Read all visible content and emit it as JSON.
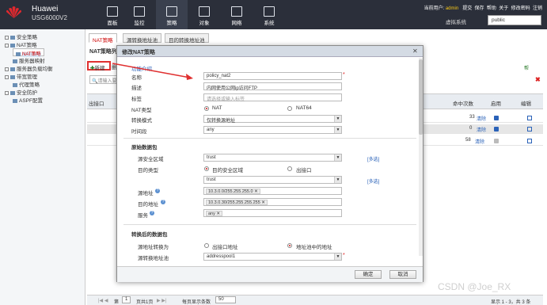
{
  "header": {
    "brand": "Huawei",
    "model": "USG6000V2",
    "nav": [
      {
        "label": "面板"
      },
      {
        "label": "监控"
      },
      {
        "label": "策略"
      },
      {
        "label": "对象"
      },
      {
        "label": "网络"
      },
      {
        "label": "系统"
      }
    ],
    "user_prefix": "当前用户:",
    "user_name": "admin",
    "actions": [
      "提交",
      "保存",
      "帮助",
      "关于",
      "修改密码",
      "注销"
    ],
    "vsys_label": "虚拟系统",
    "vsys_value": "public"
  },
  "sidebar": {
    "items": [
      {
        "label": "安全策略"
      },
      {
        "label": "NAT策略"
      },
      {
        "label": "NAT策略"
      },
      {
        "label": "服务器映射"
      },
      {
        "label": "服务器负载均衡"
      },
      {
        "label": "带宽管理"
      },
      {
        "label": "代理策略"
      },
      {
        "label": "安全防护"
      },
      {
        "label": "ASPF配置"
      }
    ]
  },
  "tabs": [
    {
      "label": "NAT策略"
    },
    {
      "label": "源转换地址池"
    },
    {
      "label": "目的转换地址池"
    }
  ],
  "list": {
    "title": "NAT策略列表",
    "new_button": "新建",
    "new_cut": "删除",
    "search_placeholder": "请输入要",
    "columns": [
      "出接口",
      "命中次数",
      "启用",
      "编辑"
    ],
    "rows": [
      {
        "a": "1",
        "hits": "33",
        "clear": "清除"
      },
      {
        "a": "1",
        "hits": "0",
        "clear": "清除"
      },
      {
        "a": "",
        "hits": "58",
        "clear": "清除"
      }
    ],
    "right_link": "帮",
    "right_del": "✖"
  },
  "pager": {
    "label_page": "第",
    "page": "1",
    "label_total": "页共1页",
    "label_per": "每页显示条数",
    "per_page": "50",
    "summary": "显示 1 - 3，共 3 条"
  },
  "dialog": {
    "title": "修改NAT策略",
    "intro": "功能介绍",
    "name_label": "名称",
    "name_value": "policy_nat2",
    "desc_label": "描述",
    "desc_value": "内网使用公网ip访问FTP",
    "tag_label": "标签",
    "tag_placeholder": "请选择或输入标签",
    "nat_type_label": "NAT类型",
    "nat_type_opt1": "NAT",
    "nat_type_opt2": "NAT64",
    "mode_label": "转换模式",
    "mode_value": "仅转换源地址",
    "time_label": "时间段",
    "time_value": "any",
    "orig_section": "原始数据包",
    "src_zone_label": "源安全区域",
    "src_zone_value": "trust",
    "multi1": "[多选]",
    "dst_type_label": "目的类型",
    "dst_type_opt1": "目的安全区域",
    "dst_type_opt2": "出接口",
    "dst_zone_value": "trust",
    "multi2": "[多选]",
    "src_addr_label": "源地址",
    "src_addr_tag": "10.3.0.0/255.255.255.0",
    "dst_addr_label": "目的地址",
    "dst_addr_tag": "10.3.0.30/255.255.255.255",
    "svc_label": "服务",
    "svc_tag": "any",
    "trans_section": "转换后的数据包",
    "src_trans_label": "源地址转换为",
    "src_trans_opt1": "出接口地址",
    "src_trans_opt2": "地址池中的地址",
    "pool_label": "源转换地址池",
    "pool_value": "addresspool1",
    "ok": "确定",
    "cancel": "取消"
  },
  "watermark": "CSDN @Joe_RX"
}
